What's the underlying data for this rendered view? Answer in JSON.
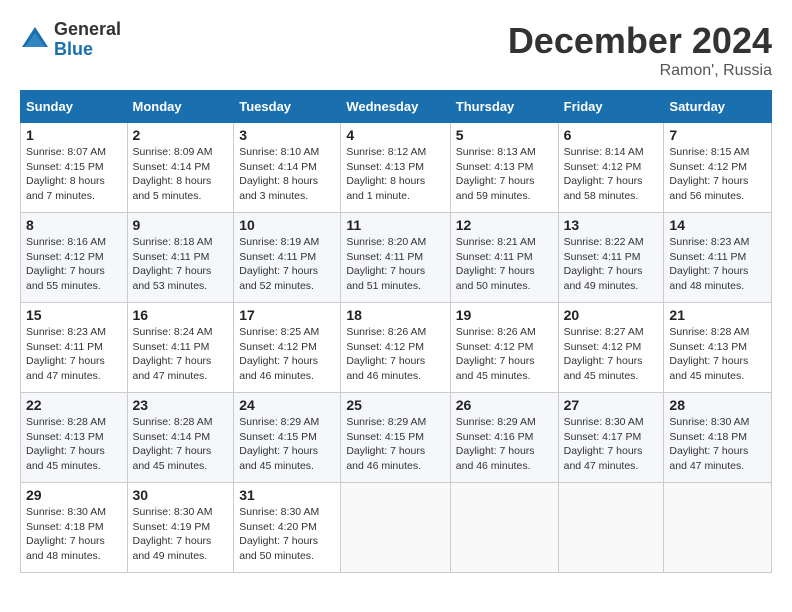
{
  "header": {
    "logo_general": "General",
    "logo_blue": "Blue",
    "month_title": "December 2024",
    "location": "Ramon', Russia"
  },
  "weekdays": [
    "Sunday",
    "Monday",
    "Tuesday",
    "Wednesday",
    "Thursday",
    "Friday",
    "Saturday"
  ],
  "weeks": [
    [
      {
        "day": "1",
        "info": "Sunrise: 8:07 AM\nSunset: 4:15 PM\nDaylight: 8 hours\nand 7 minutes."
      },
      {
        "day": "2",
        "info": "Sunrise: 8:09 AM\nSunset: 4:14 PM\nDaylight: 8 hours\nand 5 minutes."
      },
      {
        "day": "3",
        "info": "Sunrise: 8:10 AM\nSunset: 4:14 PM\nDaylight: 8 hours\nand 3 minutes."
      },
      {
        "day": "4",
        "info": "Sunrise: 8:12 AM\nSunset: 4:13 PM\nDaylight: 8 hours\nand 1 minute."
      },
      {
        "day": "5",
        "info": "Sunrise: 8:13 AM\nSunset: 4:13 PM\nDaylight: 7 hours\nand 59 minutes."
      },
      {
        "day": "6",
        "info": "Sunrise: 8:14 AM\nSunset: 4:12 PM\nDaylight: 7 hours\nand 58 minutes."
      },
      {
        "day": "7",
        "info": "Sunrise: 8:15 AM\nSunset: 4:12 PM\nDaylight: 7 hours\nand 56 minutes."
      }
    ],
    [
      {
        "day": "8",
        "info": "Sunrise: 8:16 AM\nSunset: 4:12 PM\nDaylight: 7 hours\nand 55 minutes."
      },
      {
        "day": "9",
        "info": "Sunrise: 8:18 AM\nSunset: 4:11 PM\nDaylight: 7 hours\nand 53 minutes."
      },
      {
        "day": "10",
        "info": "Sunrise: 8:19 AM\nSunset: 4:11 PM\nDaylight: 7 hours\nand 52 minutes."
      },
      {
        "day": "11",
        "info": "Sunrise: 8:20 AM\nSunset: 4:11 PM\nDaylight: 7 hours\nand 51 minutes."
      },
      {
        "day": "12",
        "info": "Sunrise: 8:21 AM\nSunset: 4:11 PM\nDaylight: 7 hours\nand 50 minutes."
      },
      {
        "day": "13",
        "info": "Sunrise: 8:22 AM\nSunset: 4:11 PM\nDaylight: 7 hours\nand 49 minutes."
      },
      {
        "day": "14",
        "info": "Sunrise: 8:23 AM\nSunset: 4:11 PM\nDaylight: 7 hours\nand 48 minutes."
      }
    ],
    [
      {
        "day": "15",
        "info": "Sunrise: 8:23 AM\nSunset: 4:11 PM\nDaylight: 7 hours\nand 47 minutes."
      },
      {
        "day": "16",
        "info": "Sunrise: 8:24 AM\nSunset: 4:11 PM\nDaylight: 7 hours\nand 47 minutes."
      },
      {
        "day": "17",
        "info": "Sunrise: 8:25 AM\nSunset: 4:12 PM\nDaylight: 7 hours\nand 46 minutes."
      },
      {
        "day": "18",
        "info": "Sunrise: 8:26 AM\nSunset: 4:12 PM\nDaylight: 7 hours\nand 46 minutes."
      },
      {
        "day": "19",
        "info": "Sunrise: 8:26 AM\nSunset: 4:12 PM\nDaylight: 7 hours\nand 45 minutes."
      },
      {
        "day": "20",
        "info": "Sunrise: 8:27 AM\nSunset: 4:12 PM\nDaylight: 7 hours\nand 45 minutes."
      },
      {
        "day": "21",
        "info": "Sunrise: 8:28 AM\nSunset: 4:13 PM\nDaylight: 7 hours\nand 45 minutes."
      }
    ],
    [
      {
        "day": "22",
        "info": "Sunrise: 8:28 AM\nSunset: 4:13 PM\nDaylight: 7 hours\nand 45 minutes."
      },
      {
        "day": "23",
        "info": "Sunrise: 8:28 AM\nSunset: 4:14 PM\nDaylight: 7 hours\nand 45 minutes."
      },
      {
        "day": "24",
        "info": "Sunrise: 8:29 AM\nSunset: 4:15 PM\nDaylight: 7 hours\nand 45 minutes."
      },
      {
        "day": "25",
        "info": "Sunrise: 8:29 AM\nSunset: 4:15 PM\nDaylight: 7 hours\nand 46 minutes."
      },
      {
        "day": "26",
        "info": "Sunrise: 8:29 AM\nSunset: 4:16 PM\nDaylight: 7 hours\nand 46 minutes."
      },
      {
        "day": "27",
        "info": "Sunrise: 8:30 AM\nSunset: 4:17 PM\nDaylight: 7 hours\nand 47 minutes."
      },
      {
        "day": "28",
        "info": "Sunrise: 8:30 AM\nSunset: 4:18 PM\nDaylight: 7 hours\nand 47 minutes."
      }
    ],
    [
      {
        "day": "29",
        "info": "Sunrise: 8:30 AM\nSunset: 4:18 PM\nDaylight: 7 hours\nand 48 minutes."
      },
      {
        "day": "30",
        "info": "Sunrise: 8:30 AM\nSunset: 4:19 PM\nDaylight: 7 hours\nand 49 minutes."
      },
      {
        "day": "31",
        "info": "Sunrise: 8:30 AM\nSunset: 4:20 PM\nDaylight: 7 hours\nand 50 minutes."
      },
      {
        "day": "",
        "info": ""
      },
      {
        "day": "",
        "info": ""
      },
      {
        "day": "",
        "info": ""
      },
      {
        "day": "",
        "info": ""
      }
    ]
  ]
}
